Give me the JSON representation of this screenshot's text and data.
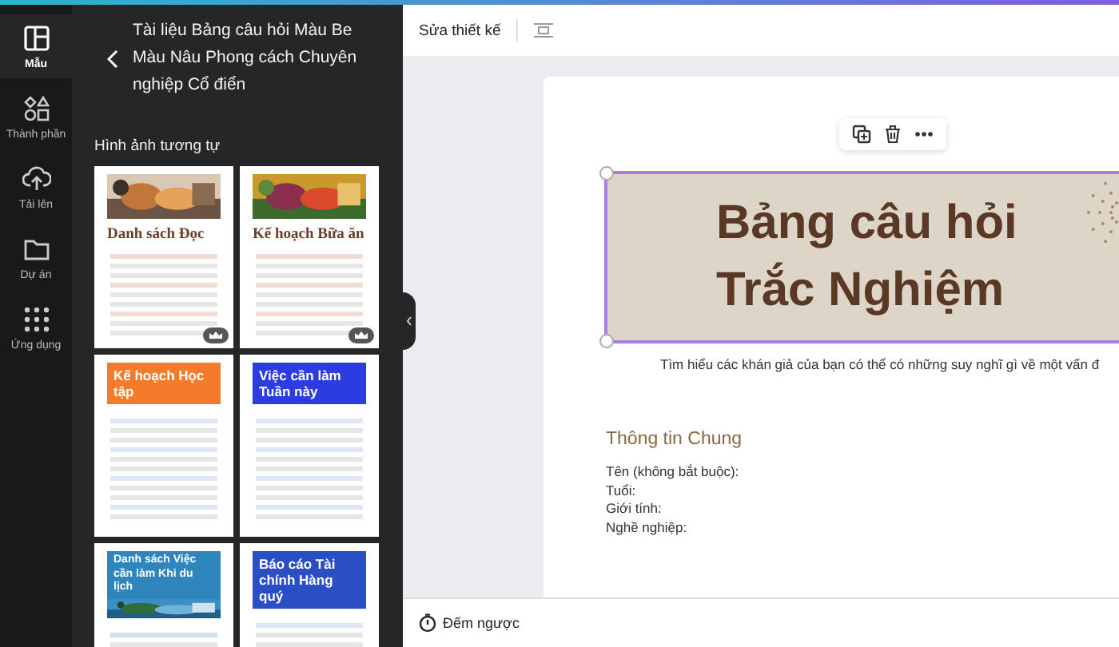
{
  "rail": [
    {
      "label": "Mẫu",
      "selected": true
    },
    {
      "label": "Thành phần",
      "selected": false
    },
    {
      "label": "Tải lên",
      "selected": false
    },
    {
      "label": "Dự án",
      "selected": false
    },
    {
      "label": "Ứng dụng",
      "selected": false
    }
  ],
  "panel": {
    "title": "Tài liệu Bảng câu hỏi Màu Be Màu Nâu Phong cách Chuyên nghiệp Cổ điển",
    "section": "Hình ảnh tương tự",
    "templates": [
      {
        "title": "Danh sách Đọc",
        "kind": "photo-top",
        "premium": true
      },
      {
        "title": "Kế hoạch Bữa ăn",
        "kind": "photo-top",
        "premium": true
      },
      {
        "title": "Kế hoạch Học tập",
        "kind": "band",
        "color": "#f47b2a",
        "premium": false
      },
      {
        "title": "Việc cần làm Tuần này",
        "kind": "band",
        "color": "#2b3de0",
        "premium": false
      },
      {
        "title": "Danh sách Việc cần làm Khi du lịch",
        "kind": "photo-band",
        "premium": false
      },
      {
        "title": "Báo cáo Tài chính Hàng quý",
        "kind": "band",
        "color": "#2a4fc4",
        "premium": false
      }
    ]
  },
  "topbar": {
    "edit": "Sửa thiết kế"
  },
  "page": {
    "title_lines": [
      "Bảng câu hỏi",
      "Trắc Nghiệm"
    ],
    "subtitle": "Tìm hiểu các khán giả của bạn có thể có những suy nghĩ gì về một vấn đ",
    "section": "Thông tin Chung",
    "fields": [
      "Tên (không bắt buộc):",
      "Tuổi:",
      "Giới tính:",
      "Nghề nghiệp:"
    ]
  },
  "bottombar": {
    "timer": "Đếm ngược"
  }
}
